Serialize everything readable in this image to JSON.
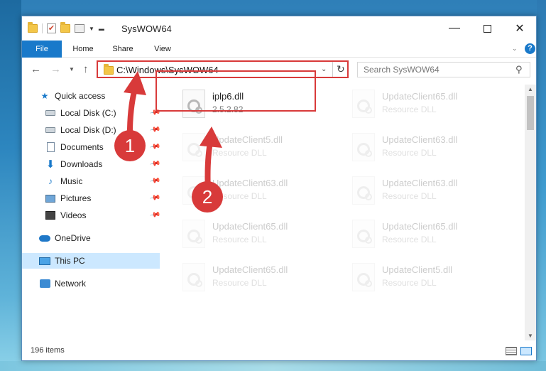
{
  "window": {
    "title": "SysWOW64"
  },
  "ribbon": {
    "tabs": [
      "File",
      "Home",
      "Share",
      "View"
    ]
  },
  "address": {
    "path": "C:\\Windows\\SysWOW64"
  },
  "search": {
    "placeholder": "Search SysWOW64"
  },
  "nav": {
    "quick_access": "Quick access",
    "items": [
      {
        "label": "Local Disk (C:)",
        "icon": "disk-icon"
      },
      {
        "label": "Local Disk (D:)",
        "icon": "disk-icon"
      },
      {
        "label": "Documents",
        "icon": "documents-icon"
      },
      {
        "label": "Downloads",
        "icon": "downloads-icon"
      },
      {
        "label": "Music",
        "icon": "music-icon"
      },
      {
        "label": "Pictures",
        "icon": "pictures-icon"
      },
      {
        "label": "Videos",
        "icon": "videos-icon"
      }
    ],
    "onedrive": "OneDrive",
    "this_pc": "This PC",
    "network": "Network"
  },
  "files": [
    {
      "name": "iplp6.dll",
      "sub": "2.5.2.82",
      "faded": false
    },
    {
      "name": "UpdateClient65.dll",
      "sub": "Resource DLL",
      "faded": true
    },
    {
      "name": "UpdateClient5.dll",
      "sub": "Resource DLL",
      "faded": true
    },
    {
      "name": "UpdateClient63.dll",
      "sub": "Resource DLL",
      "faded": true
    },
    {
      "name": "UpdateClient63.dll",
      "sub": "Resource DLL",
      "faded": true
    },
    {
      "name": "UpdateClient63.dll",
      "sub": "Resource DLL",
      "faded": true
    },
    {
      "name": "UpdateClient65.dll",
      "sub": "Resource DLL",
      "faded": true
    },
    {
      "name": "UpdateClient65.dll",
      "sub": "Resource DLL",
      "faded": true
    },
    {
      "name": "UpdateClient65.dll",
      "sub": "Resource DLL",
      "faded": true
    },
    {
      "name": "UpdateClient5.dll",
      "sub": "Resource DLL",
      "faded": true
    }
  ],
  "status": {
    "item_count": "196 items"
  },
  "annotations": {
    "step1": "1",
    "step2": "2",
    "color": "#d83a3a"
  }
}
